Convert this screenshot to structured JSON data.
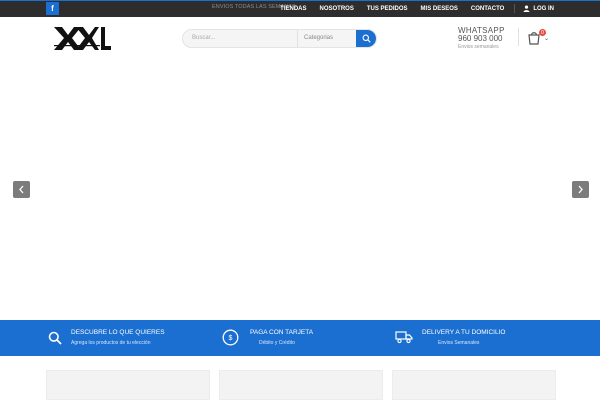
{
  "topbar": {
    "facebook_icon": "facebook-icon",
    "shipping_text": "ENVIOS TODAS LAS SEMANAS",
    "nav": [
      {
        "label": "TIENDAS"
      },
      {
        "label": "NOSOTROS"
      },
      {
        "label": "TUS PEDIDOS"
      },
      {
        "label": "MIS DESEOS"
      },
      {
        "label": "CONTACTO"
      }
    ],
    "login_label": "LOG IN"
  },
  "header": {
    "logo_icon": "xxl-logo",
    "search": {
      "placeholder": "Buscar...",
      "category_label": "Categorias"
    },
    "whatsapp": {
      "label": "WHATSAPP",
      "number": "960 903 000",
      "note": "Envios semanales"
    },
    "cart_count": "0"
  },
  "features": [
    {
      "icon": "search-icon",
      "title": "DESCUBRE LO QUE QUIERES",
      "subtitle": "Agrega los productos de tu elección"
    },
    {
      "icon": "card-icon",
      "title": "PAGA CON TARJETA",
      "subtitle": "Débito y Crédito"
    },
    {
      "icon": "truck-icon",
      "title": "DELIVERY A TU DOMICILIO",
      "subtitle": "Envios Semanales"
    }
  ],
  "colors": {
    "accent": "#1b6fd1",
    "topbar": "#2d2d2d",
    "badge": "#e94b3c"
  }
}
